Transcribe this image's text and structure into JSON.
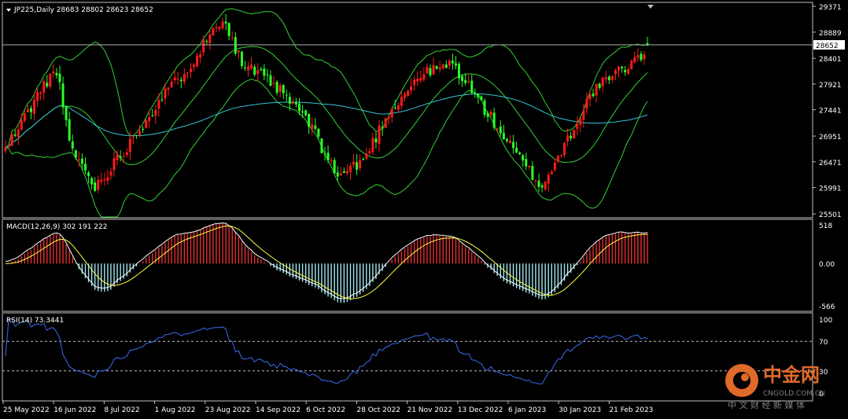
{
  "colors": {
    "background": "#000000",
    "frame": "#c0c0c0",
    "text": "#ffffff",
    "candle_up": "#ff1a1a",
    "candle_down": "#2aff2a",
    "bollinger": "#34d034",
    "moving_average": "#36c5d8",
    "macd_hist_positive": "#e83030",
    "macd_hist_negative": "#9fe8f0",
    "macd_line": "#ffffff",
    "signal_line": "#ffff40",
    "rsi_line": "#3c6cf0",
    "current_price_line": "#b0b0b0",
    "watermark_primary": "#e06a2a",
    "watermark_text": "#808080"
  },
  "icons": {
    "menu_marker": "triangle-down-icon",
    "watermark_logo": "swirl-logo-icon"
  },
  "watermark": {
    "title": "中金网",
    "url": "CNGOLD.COM.CN",
    "subtitle": "中 文 财 经 新 媒 体"
  },
  "price_panel": {
    "label": "JP225,Daily  28683 28802 28623 28652",
    "current_price": 28652,
    "current_price_label": "28652",
    "ticks": [
      {
        "v": 29371,
        "t": "29371"
      },
      {
        "v": 28889,
        "t": "28889"
      },
      {
        "v": 28401,
        "t": "28401"
      },
      {
        "v": 27921,
        "t": "27921"
      },
      {
        "v": 27441,
        "t": "27441"
      },
      {
        "v": 26951,
        "t": "26951"
      },
      {
        "v": 26471,
        "t": "26471"
      },
      {
        "v": 25991,
        "t": "25991"
      },
      {
        "v": 25501,
        "t": "25501"
      }
    ]
  },
  "macd_panel": {
    "label": "MACD(12,26,9) 302 191 222",
    "ticks": [
      {
        "v": 518,
        "t": "518"
      },
      {
        "v": 0,
        "t": "0.00"
      },
      {
        "v": -566,
        "t": "-566"
      }
    ]
  },
  "rsi_panel": {
    "label": "RSI(14) 73.3441",
    "ticks": [
      {
        "v": 100,
        "t": "100"
      },
      {
        "v": 70,
        "t": "70"
      },
      {
        "v": 30,
        "t": "30"
      },
      {
        "v": 0,
        "t": "0"
      }
    ],
    "levels": [
      70,
      30
    ]
  },
  "x_labels": [
    "25 May 2022",
    "16 Jun 2022",
    "8 Jul 2022",
    "1 Aug 2022",
    "23 Aug 2022",
    "14 Sep 2022",
    "6 Oct 2022",
    "28 Oct 2022",
    "21 Nov 2022",
    "13 Dec 2022",
    "6 Jan 2023",
    "30 Jan 2023",
    "21 Feb 2023"
  ],
  "chart_data": {
    "type": "candlestick",
    "symbol": "JP225",
    "timeframe": "Daily",
    "num_bars": 202,
    "ohlc_last": {
      "open": 28683,
      "high": 28802,
      "low": 28623,
      "close": 28652
    },
    "close_path": [
      [
        0,
        26700
      ],
      [
        12,
        27900
      ],
      [
        16,
        28200
      ],
      [
        20,
        26800
      ],
      [
        28,
        26000
      ],
      [
        36,
        26600
      ],
      [
        48,
        27600
      ],
      [
        58,
        28300
      ],
      [
        68,
        29200
      ],
      [
        74,
        28300
      ],
      [
        84,
        27900
      ],
      [
        94,
        27300
      ],
      [
        104,
        26200
      ],
      [
        112,
        26500
      ],
      [
        120,
        27400
      ],
      [
        130,
        28100
      ],
      [
        140,
        28300
      ],
      [
        146,
        27800
      ],
      [
        160,
        26600
      ],
      [
        168,
        26000
      ],
      [
        184,
        27800
      ],
      [
        200,
        28500
      ],
      [
        202,
        28652
      ]
    ],
    "ylim_price": [
      25501,
      29371
    ],
    "indicators": {
      "bollinger_bands": true,
      "moving_average": true,
      "macd": {
        "fast": 12,
        "slow": 26,
        "signal": 9,
        "main": 302,
        "signal_value": 191,
        "histogram": 222,
        "ylim": [
          -566,
          518
        ]
      },
      "rsi": {
        "period": 14,
        "value": 73.3441,
        "ylim": [
          0,
          100
        ],
        "levels": [
          70,
          30
        ]
      }
    }
  }
}
